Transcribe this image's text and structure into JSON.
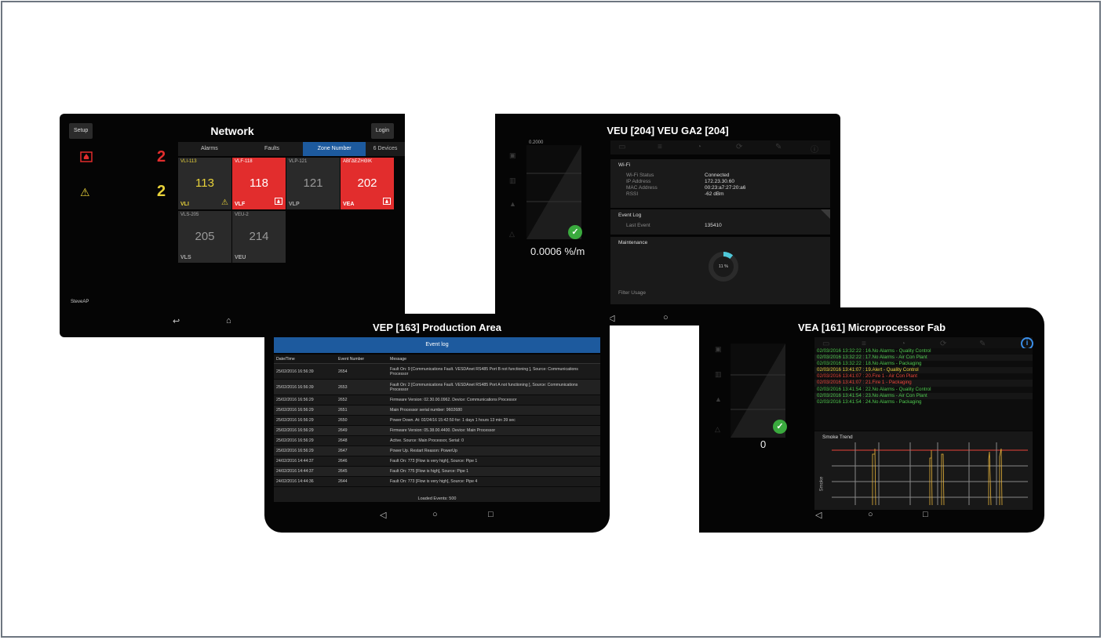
{
  "network": {
    "setup": "Setup",
    "title": "Network",
    "login": "Login",
    "tabs": [
      "Alarms",
      "Faults",
      "Zone Number",
      "6 Devices"
    ],
    "alarm_count": "2",
    "fault_count": "2",
    "tiles": [
      {
        "code": "VLI-113",
        "num": "113",
        "type": "VLI"
      },
      {
        "code": "VLF-118",
        "num": "118",
        "type": "VLF"
      },
      {
        "code": "VLP-121",
        "num": "121",
        "type": "VLP"
      },
      {
        "code": "ΑΒΓΔΕΖΗΘΙΚ",
        "num": "202",
        "type": "VEA"
      },
      {
        "code": "VLS-205",
        "num": "205",
        "type": "VLS"
      },
      {
        "code": "VEU-2",
        "num": "214",
        "type": "VEU"
      }
    ],
    "ssid": "SteveAP",
    "colors": {
      "red": "#e22d2d",
      "yellow": "#e8d23a",
      "tab_active": "#1d5a9e"
    }
  },
  "veu": {
    "title": "VEU  [204]  VEU GA2 [204]",
    "gauge_top": "0.2000",
    "reading": "0.0006 %/m",
    "wifi": {
      "title": "Wi-Fi",
      "rows": [
        {
          "k": "Wi-Fi Status",
          "v": "Connected"
        },
        {
          "k": "IP Address",
          "v": "172.23.30.60"
        },
        {
          "k": "MAC Address",
          "v": "00:23:a7:27:20:a6"
        },
        {
          "k": "RSSI",
          "v": "-62 dBm"
        }
      ]
    },
    "eventlog": {
      "title": "Event Log",
      "k": "Last Event",
      "v": "135410"
    },
    "maintenance": {
      "title": "Maintenance",
      "percent": "11 %",
      "filter": "Filter Usage",
      "fill": 0.11
    }
  },
  "vep": {
    "title": "VEP  [163]  Production Area",
    "header": "Event log",
    "columns": [
      "Date/Time",
      "Event Number",
      "Message"
    ],
    "rows": [
      {
        "d": "25/02/2016 16:56:39",
        "n": "2654",
        "m": "Fault On: 9 [Communications Fault. VESDAnet RS485 Port B not functioning ], Source: Communications Processor"
      },
      {
        "d": "25/02/2016 16:56:39",
        "n": "2653",
        "m": "Fault On: 2 [Communications Fault. VESDAnet RS485 Port A not functioning ], Source: Communications Processor"
      },
      {
        "d": "25/02/2016 16:56:29",
        "n": "2652",
        "m": "Firmware Version: 02.30.00.0962. Device: Communications Processor"
      },
      {
        "d": "25/02/2016 16:56:29",
        "n": "2651",
        "m": "Main Processor serial number: 9602680"
      },
      {
        "d": "25/02/2016 16:56:29",
        "n": "2650",
        "m": "Power Down. At: 02/24/16 15:42:50 for: 1 days 1 hours 13 min 39 sec"
      },
      {
        "d": "25/02/2016 16:56:29",
        "n": "2649",
        "m": "Firmware Version: 05.38.00.4400. Device: Main Processor"
      },
      {
        "d": "25/02/2016 16:56:29",
        "n": "2648",
        "m": "Active. Source: Main Processor, Serial: 0"
      },
      {
        "d": "25/02/2016 16:56:29",
        "n": "2647",
        "m": "Power Up. Restart Reason: PowerUp"
      },
      {
        "d": "24/02/2016 14:44:37",
        "n": "2646",
        "m": "Fault On: 773 [Flow is very high], Source: Pipe 1"
      },
      {
        "d": "24/02/2016 14:44:37",
        "n": "2645",
        "m": "Fault On: 775 [Flow is high], Source: Pipe 1"
      },
      {
        "d": "24/02/2016 14:44:36",
        "n": "2644",
        "m": "Fault On: 773 [Flow is very high], Source: Pipe 4"
      }
    ],
    "loaded": "Loaded Events: 500"
  },
  "vea": {
    "title": "VEA  [161]  Microprocessor Fab",
    "reading": "0",
    "log": [
      {
        "t": "02/03/2016 13:32:22 : 16.No Alarms - Quality Control",
        "c": "#4fc94f"
      },
      {
        "t": "02/03/2016 13:32:22 : 17.No Alarms - Air Con Plant",
        "c": "#4fc94f"
      },
      {
        "t": "02/03/2016 13:32:22 : 18.No Alarms - Packaging",
        "c": "#4fc94f"
      },
      {
        "t": "02/03/2016 13:41:07 : 19.Alert - Quality Control",
        "c": "#e8d23a"
      },
      {
        "t": "02/03/2016 13:41:07 : 20.Fire 1 - Air Con Plant",
        "c": "#e8443a"
      },
      {
        "t": "02/03/2016 13:41:07 : 21.Fire 1 - Packaging",
        "c": "#e8443a"
      },
      {
        "t": "02/03/2016 13:41:54 : 22.No Alarms - Quality Control",
        "c": "#4fc94f"
      },
      {
        "t": "02/03/2016 13:41:54 : 23.No Alarms - Air Con Plant",
        "c": "#4fc94f"
      },
      {
        "t": "02/03/2016 13:41:54 : 24.No Alarms - Packaging",
        "c": "#4fc94f"
      }
    ],
    "trend_title": "Smoke Trend",
    "trend_ylabel": "Smoke"
  }
}
